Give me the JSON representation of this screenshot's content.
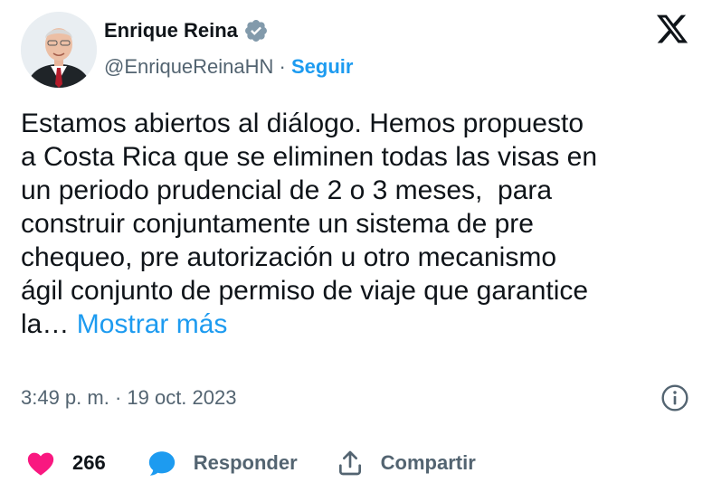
{
  "author": {
    "name": "Enrique Reina",
    "handle": "@EnriqueReinaHN",
    "separator": "·",
    "follow_label": "Seguir"
  },
  "tweet": {
    "lines": [
      "Estamos abiertos al diálogo. Hemos propuesto",
      "a Costa Rica que se eliminen todas las visas en",
      "un periodo prudencial de 2 o 3 meses,  para",
      "construir conjuntamente un sistema de pre",
      "chequeo, pre autorización u otro mecanismo",
      "ágil conjunto de permiso de viaje que garantice"
    ],
    "last_line_text": "la…",
    "show_more_label": "Mostrar más"
  },
  "meta": {
    "timestamp": "3:49 p. m. · 19 oct. 2023"
  },
  "actions": {
    "like_count": "266",
    "reply_label": "Responder",
    "share_label": "Compartir"
  },
  "icons": {
    "verified": "verified-badge-icon",
    "brand": "x-logo-icon",
    "info": "info-icon",
    "like": "heart-icon",
    "reply": "speech-bubble-icon",
    "share": "share-icon"
  },
  "colors": {
    "link": "#1d9bf0",
    "like": "#f91880",
    "text": "#0f1419",
    "secondary": "#536471"
  }
}
